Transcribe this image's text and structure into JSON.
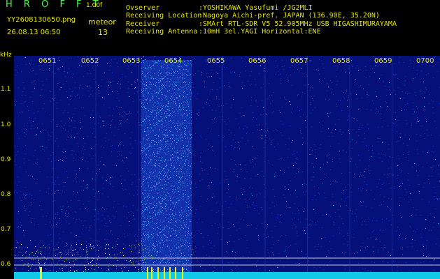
{
  "app": {
    "title": "H R O F F T",
    "version": "1.00f"
  },
  "file": {
    "name": "YY2608130650.png",
    "datetime": "26.08.13 06:50"
  },
  "meteor": {
    "label": "meteor",
    "count": "13"
  },
  "info": [
    {
      "label": "Ovserver",
      "value": ":YOSHIKAWA Yasufumi /JG2MLI"
    },
    {
      "label": "Receiving Location",
      "value": ":Nagoya Aichi-pref. JAPAN (136.90E, 35.20N)"
    },
    {
      "label": "Receiver",
      "value": ":SMArt RTL-SDR V5 52.905MHz USB HIGASHIMURAYAMA"
    },
    {
      "label": "Receiving Antenna",
      "value": ":10mH 3el.YAGI Horizontal:ENE"
    }
  ],
  "axis": {
    "unit": "kHz",
    "y_ticks": [
      "1.1",
      "1.0",
      "0.9",
      "0.8",
      "0.7",
      "0.6"
    ],
    "x_ticks": [
      "0651",
      "0652",
      "0653",
      "0654",
      "0655",
      "0656",
      "0657",
      "0658",
      "0659",
      "0700"
    ]
  },
  "colors": {
    "background": "#000000",
    "text": "#e6e600",
    "title": "#46ff46",
    "noise_low": "#0a1a8c",
    "noise_high": "#30d0ff"
  }
}
